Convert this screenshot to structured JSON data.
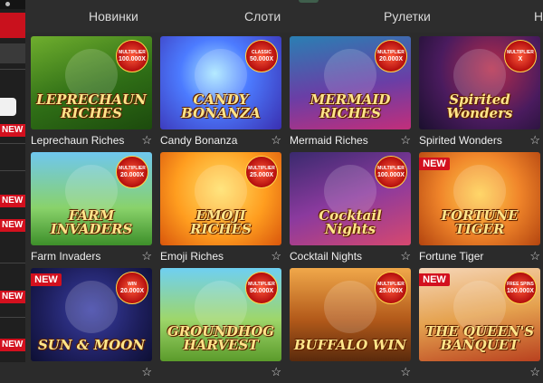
{
  "nav": {
    "tabs": [
      "Новинки",
      "Слоти",
      "Рулетки",
      "Н"
    ]
  },
  "sidebar": {
    "new_labels": [
      "NEW",
      "NEW",
      "NEW",
      "NEW",
      "NEW"
    ]
  },
  "games": [
    {
      "name": "Leprechaun Riches",
      "art_title": "LEPRECHAUN RICHES",
      "badge": {
        "line1": "MULTIPLIER",
        "line2": "100.000X"
      },
      "is_new": false
    },
    {
      "name": "Candy Bonanza",
      "art_title": "CANDY BONANZA",
      "badge": {
        "line1": "CLASSIC",
        "line2": "50.000X"
      },
      "is_new": false
    },
    {
      "name": "Mermaid Riches",
      "art_title": "MERMAID RICHES",
      "badge": {
        "line1": "MULTIPLIER",
        "line2": "20.000X"
      },
      "is_new": false
    },
    {
      "name": "Spirited Wonders",
      "art_title": "Spirited Wonders",
      "badge": {
        "line1": "MULTIPLIER",
        "line2": "X"
      },
      "is_new": false
    },
    {
      "name": "Farm Invaders",
      "art_title": "FARM INVADERS",
      "badge": {
        "line1": "MULTIPLIER",
        "line2": "20.000X"
      },
      "is_new": false
    },
    {
      "name": "Emoji Riches",
      "art_title": "EMOJI RICHES",
      "badge": {
        "line1": "MULTIPLIER",
        "line2": "25.000X"
      },
      "is_new": false
    },
    {
      "name": "Cocktail Nights",
      "art_title": "Cocktail Nights",
      "badge": {
        "line1": "MULTIPLIER",
        "line2": "100.000X"
      },
      "is_new": false
    },
    {
      "name": "Fortune Tiger",
      "art_title": "FORTUNE TIGER",
      "badge": null,
      "is_new": true
    },
    {
      "name": "",
      "art_title": "SUN & MOON",
      "badge": {
        "line1": "WIN",
        "line2": "20.000X"
      },
      "is_new": true
    },
    {
      "name": "",
      "art_title": "GROUNDHOG HARVEST",
      "badge": {
        "line1": "MULTIPLIER",
        "line2": "50.000X"
      },
      "is_new": false
    },
    {
      "name": "",
      "art_title": "BUFFALO WIN",
      "badge": {
        "line1": "MULTIPLIER",
        "line2": "25.000X"
      },
      "is_new": false
    },
    {
      "name": "",
      "art_title": "THE QUEEN'S BANQUET",
      "badge": {
        "line1": "FREE SPINS",
        "line2": "100.000X"
      },
      "is_new": true
    }
  ],
  "new_label": "NEW",
  "favorite_glyph": "☆"
}
